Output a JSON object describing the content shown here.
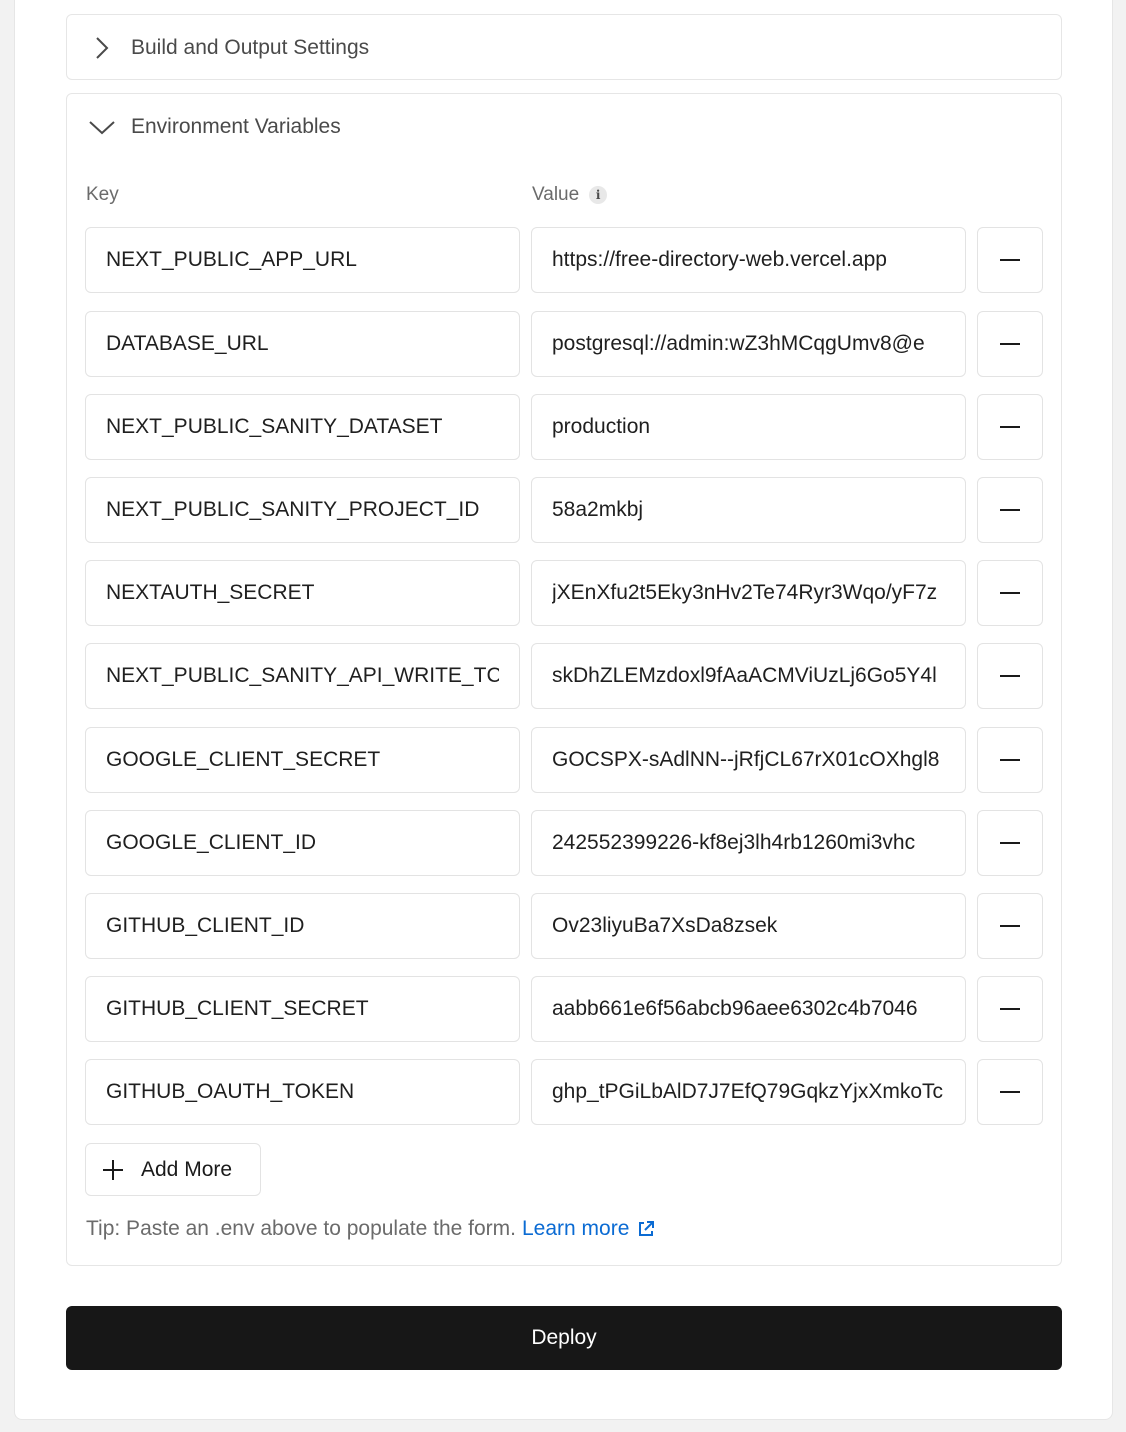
{
  "build_section": {
    "title": "Build and Output Settings"
  },
  "env_section": {
    "title": "Environment Variables",
    "key_label": "Key",
    "value_label": "Value",
    "rows": [
      {
        "key": "NEXT_PUBLIC_APP_URL",
        "value": "https://free-directory-web.vercel.app"
      },
      {
        "key": "DATABASE_URL",
        "value": "postgresql://admin:wZ3hMCqgUmv8@e"
      },
      {
        "key": "NEXT_PUBLIC_SANITY_DATASET",
        "value": "production"
      },
      {
        "key": "NEXT_PUBLIC_SANITY_PROJECT_ID",
        "value": "58a2mkbj"
      },
      {
        "key": "NEXTAUTH_SECRET",
        "value": "jXEnXfu2t5Eky3nHv2Te74Ryr3Wqo/yF7z"
      },
      {
        "key": "NEXT_PUBLIC_SANITY_API_WRITE_TC",
        "value": "skDhZLEMzdoxl9fAaACMViUzLj6Go5Y4l"
      },
      {
        "key": "GOOGLE_CLIENT_SECRET",
        "value": "GOCSPX-sAdlNN--jRfjCL67rX01cOXhgl8"
      },
      {
        "key": "GOOGLE_CLIENT_ID",
        "value": "242552399226-kf8ej3lh4rb1260mi3vhc"
      },
      {
        "key": "GITHUB_CLIENT_ID",
        "value": "Ov23liyuBa7XsDa8zsek"
      },
      {
        "key": "GITHUB_CLIENT_SECRET",
        "value": "aabb661e6f56abcb96aee6302c4b7046"
      },
      {
        "key": "GITHUB_OAUTH_TOKEN",
        "value": "ghp_tPGiLbAlD7J7EfQ79GqkzYjxXmkoTc"
      }
    ],
    "add_more_label": "Add More",
    "tip_text": "Tip: Paste an .env above to populate the form.",
    "learn_more_label": "Learn more"
  },
  "deploy_label": "Deploy",
  "colors": {
    "primary_button": "#171717",
    "link": "#0b6bd3"
  },
  "icons": [
    "chevron-right-icon",
    "chevron-down-icon",
    "info-icon",
    "minus-icon",
    "plus-icon",
    "external-link-icon"
  ]
}
